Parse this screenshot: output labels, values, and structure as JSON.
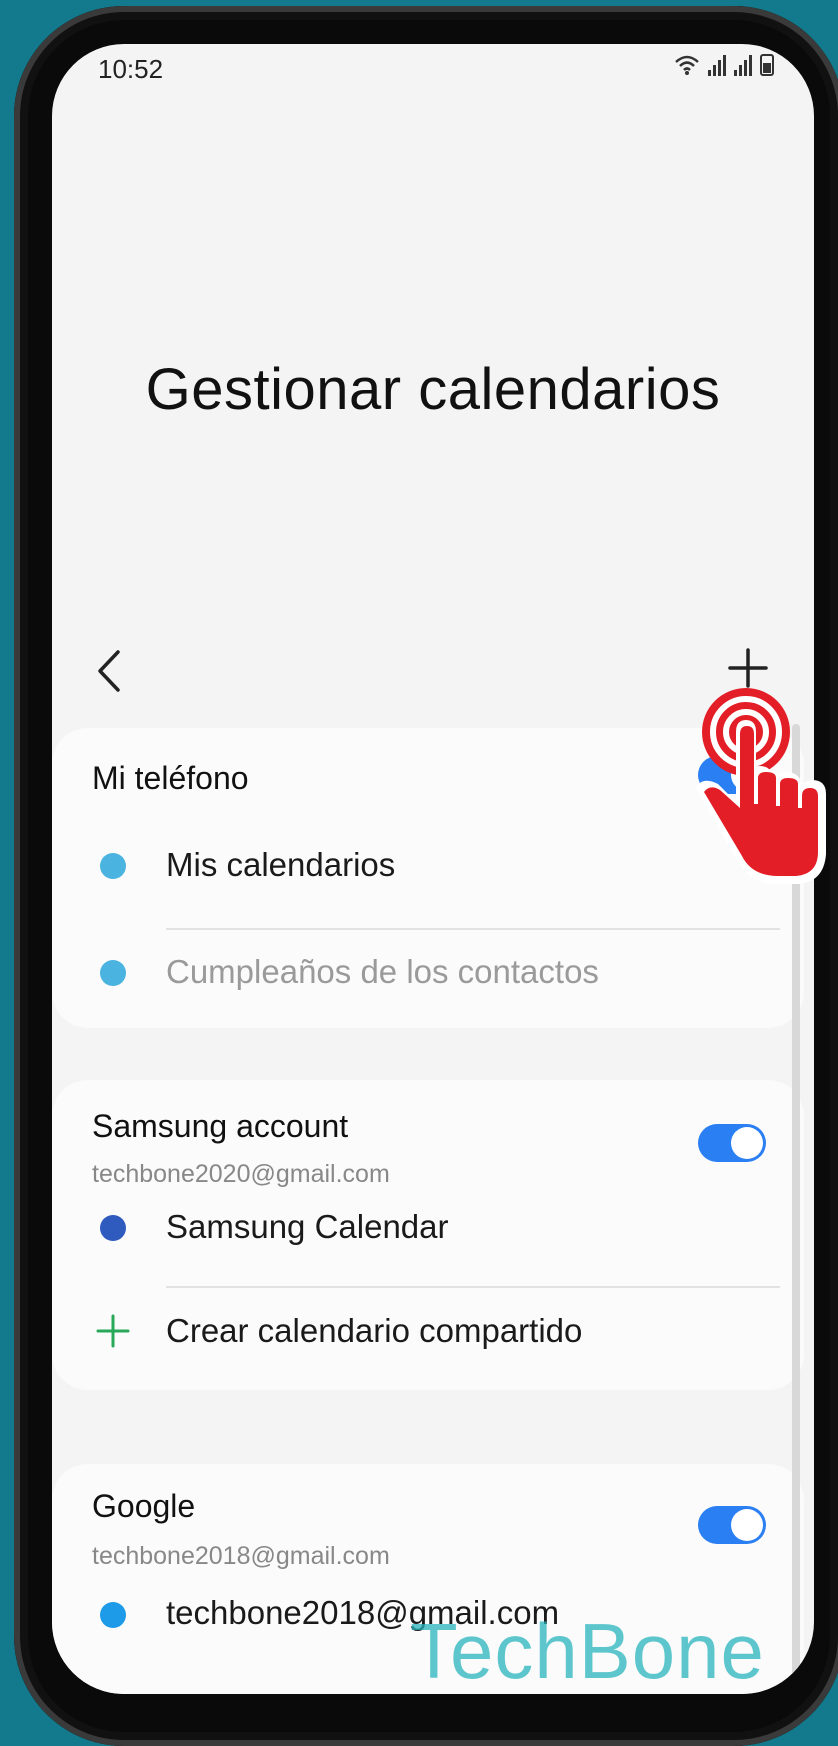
{
  "status_bar": {
    "time": "10:52"
  },
  "page": {
    "title": "Gestionar calendarios"
  },
  "nav": {
    "back_icon": "chevron-left-icon",
    "add_icon": "plus-icon"
  },
  "sections": {
    "my_phone": {
      "title": "Mi teléfono",
      "toggle_on": true,
      "items": [
        {
          "label": "Mis calendarios",
          "color": "#4ab3e0",
          "dimmed": false
        },
        {
          "label": "Cumpleaños de los contactos",
          "color": "#4ab3e0",
          "dimmed": true
        }
      ]
    },
    "samsung": {
      "title": "Samsung account",
      "subtitle": "techbone2020@gmail.com",
      "toggle_on": true,
      "items": [
        {
          "label": "Samsung Calendar",
          "color": "#2f5bbf"
        },
        {
          "label": "Crear calendario compartido",
          "icon": "plus-icon",
          "color": "#2aa85a"
        }
      ]
    },
    "google": {
      "title": "Google",
      "subtitle": "techbone2018@gmail.com",
      "toggle_on": true,
      "items": [
        {
          "label": "techbone2018@gmail.com",
          "color": "#1e9be8"
        }
      ]
    }
  },
  "overlay": {
    "watermark": "TechBone",
    "tap_indicator_icon": "hand-pointer-icon",
    "tap_color": "#e41e26"
  },
  "colors": {
    "accent": "#2a7ff2",
    "background": "#127a8c"
  }
}
